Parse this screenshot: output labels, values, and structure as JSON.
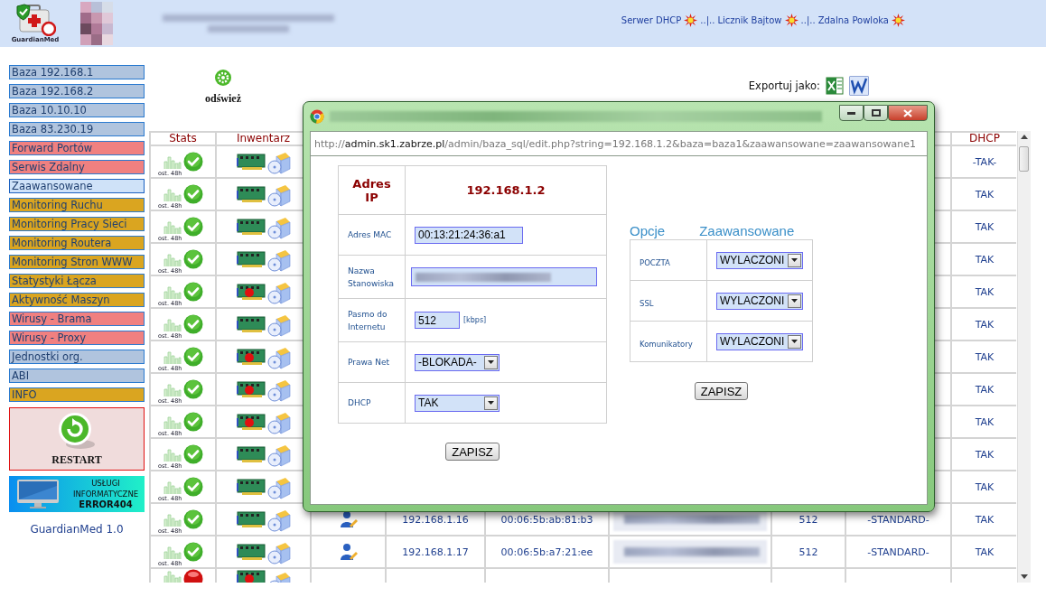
{
  "header": {
    "logo_text": "GuardianMed",
    "nav": [
      {
        "kind": "link",
        "label": "Serwer DHCP"
      },
      {
        "kind": "separator",
        "label": "..|.."
      },
      {
        "kind": "link",
        "label": "Licznik Bajtow"
      },
      {
        "kind": "separator",
        "label": "..|.."
      },
      {
        "kind": "link",
        "label": "Zdalna Powloka"
      }
    ]
  },
  "sidebar": {
    "items": [
      {
        "label": "Baza 192.168.1",
        "color": "#b0c4de",
        "selected": false
      },
      {
        "label": "Baza 192.168.2",
        "color": "#b0c4de",
        "selected": false
      },
      {
        "label": "Baza 10.10.10",
        "color": "#b0c4de",
        "selected": false
      },
      {
        "label": "Baza 83.230.19",
        "color": "#b0c4de",
        "selected": false
      },
      {
        "label": "Forward Portów",
        "color": "#f08080",
        "selected": false
      },
      {
        "label": "Serwis Zdalny",
        "color": "#f08080",
        "selected": false
      },
      {
        "label": "Zaawansowane",
        "color": "#cfe2f8",
        "selected": true
      },
      {
        "label": "Monitoring Ruchu",
        "color": "#daa520",
        "selected": false
      },
      {
        "label": "Monitoring Pracy Sieci",
        "color": "#daa520",
        "selected": false
      },
      {
        "label": "Monitoring Routera",
        "color": "#daa520",
        "selected": false
      },
      {
        "label": "Monitoring Stron WWW",
        "color": "#daa520",
        "selected": false
      },
      {
        "label": "Statystyki Łącza",
        "color": "#daa520",
        "selected": false
      },
      {
        "label": "Aktywność Maszyn",
        "color": "#daa520",
        "selected": false
      },
      {
        "label": "Wirusy - Brama",
        "color": "#f08080",
        "selected": false
      },
      {
        "label": "Wirusy - Proxy",
        "color": "#f08080",
        "selected": false
      },
      {
        "label": "Jednostki org.",
        "color": "#b0c4de",
        "selected": false
      },
      {
        "label": "ABI",
        "color": "#b0c4de",
        "selected": false
      },
      {
        "label": "INFO",
        "color": "#daa520",
        "selected": false
      }
    ],
    "restart": "RESTART",
    "banner": {
      "line_1": "USŁUGI",
      "line_2": "INFORMATYCZNE",
      "brand": "ERROR404"
    },
    "version": "GuardianMed 1.0"
  },
  "toolbar": {
    "refresh": "odśwież",
    "export_label": "Exportuj jako:"
  },
  "table": {
    "columns": [
      "Stats",
      "Inwentarz",
      "DHCP"
    ],
    "rows": [
      {
        "online": true,
        "card_alert": false,
        "caption": "ost. 48h",
        "dhcp": "-TAK-"
      },
      {
        "online": true,
        "card_alert": false,
        "caption": "ost. 48h",
        "dhcp": "TAK"
      },
      {
        "online": true,
        "card_alert": false,
        "caption": "ost. 48h",
        "dhcp": "TAK"
      },
      {
        "online": true,
        "card_alert": false,
        "caption": "ost. 48h",
        "dhcp": "TAK"
      },
      {
        "online": true,
        "card_alert": true,
        "caption": "ost. 48h",
        "dhcp": "TAK"
      },
      {
        "online": true,
        "card_alert": false,
        "caption": "ost. 48h",
        "dhcp": "TAK"
      },
      {
        "online": true,
        "card_alert": true,
        "caption": "ost. 48h",
        "dhcp": "TAK"
      },
      {
        "online": true,
        "card_alert": true,
        "caption": "ost. 48h",
        "dhcp": "TAK"
      },
      {
        "online": true,
        "card_alert": true,
        "caption": "ost. 48h",
        "dhcp": "TAK"
      },
      {
        "online": true,
        "card_alert": false,
        "caption": "ost. 48h",
        "dhcp": "TAK"
      },
      {
        "online": true,
        "card_alert": false,
        "caption": "ost. 48h",
        "dhcp": "TAK"
      },
      {
        "online": true,
        "card_alert": false,
        "caption": "ost. 48h",
        "ip": "192.168.1.16",
        "mac": "00:06:5b:ab:81:b3",
        "name_blurred": true,
        "bandwidth": "512",
        "rights": "-STANDARD-",
        "dhcp": "TAK"
      },
      {
        "online": true,
        "card_alert": false,
        "caption": "ost. 48h",
        "ip": "192.168.1.17",
        "mac": "00:06:5b:a7:21:ee",
        "name_blurred": true,
        "bandwidth": "512",
        "rights": "-STANDARD-",
        "dhcp": "TAK"
      },
      {
        "online": false,
        "card_alert": true
      }
    ]
  },
  "popup": {
    "url": {
      "scheme": "http://",
      "host": "admin.sk1.zabrze.pl",
      "path": "/admin/baza_sql/edit.php?string=192.168.1.2&baza=baza1&zaawansowane=zaawansowane1"
    },
    "ip_label": "Adres IP",
    "ip_value": "192.168.1.2",
    "fields": [
      {
        "kind": "input",
        "label": "Adres MAC",
        "value": "00:13:21:24:36:a1"
      },
      {
        "kind": "blurred",
        "label": "Nazwa Stanowiska"
      },
      {
        "kind": "input",
        "label": "Pasmo do Internetu",
        "value": "512",
        "unit": "[kbps]"
      },
      {
        "kind": "select",
        "label": "Prawa Net",
        "value": "-BLOKADA-"
      },
      {
        "kind": "select",
        "label": "DHCP",
        "value": "TAK"
      }
    ],
    "save": "ZAPISZ",
    "options_heading": [
      "Opcje",
      "Zaawansowane"
    ],
    "options": [
      {
        "label": "POCZTA",
        "value": "WYLACZONI"
      },
      {
        "label": "SSL",
        "value": "WYLACZONI"
      },
      {
        "label": "Komunikatory",
        "value": "WYLACZONI"
      }
    ],
    "options_save": "ZAPISZ"
  }
}
